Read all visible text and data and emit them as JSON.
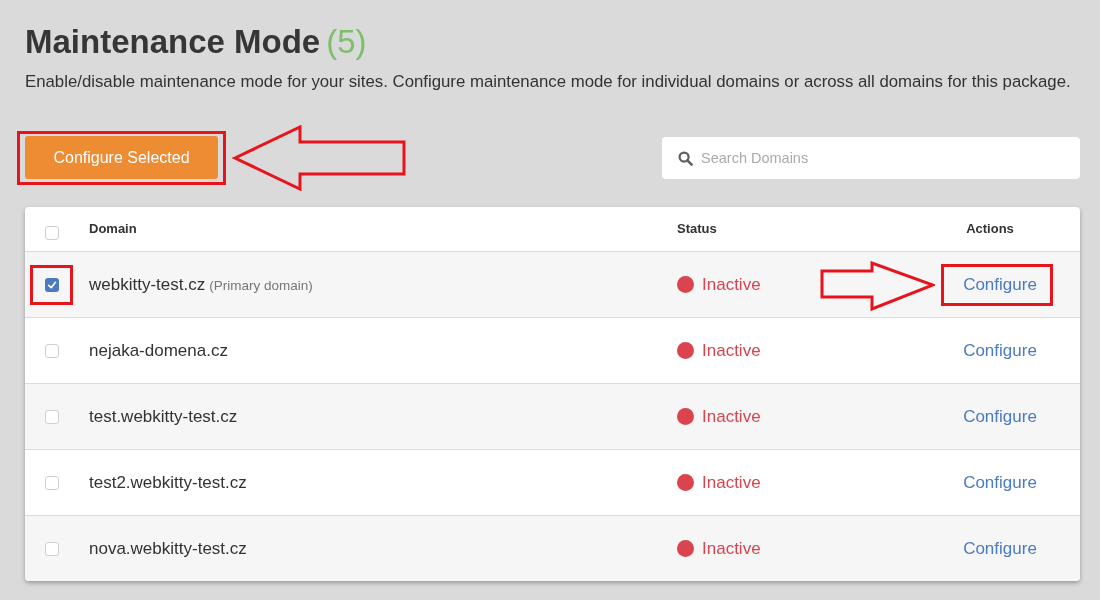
{
  "header": {
    "title": "Maintenance Mode",
    "count": "(5)",
    "description": "Enable/disable maintenance mode for your sites. Configure maintenance mode for individual domains or across all domains for this package."
  },
  "toolbar": {
    "configure_selected_button": {
      "label": "Configure Selected",
      "highlighted": true
    },
    "search": {
      "placeholder": "Search Domains"
    }
  },
  "table": {
    "select_all": {
      "checked": false
    },
    "columns": [
      "Domain",
      "Status",
      "Actions"
    ],
    "rows": [
      {
        "checked": true,
        "highlighted": true,
        "domain": "webkitty-test.cz",
        "note": "(Primary domain)",
        "status": {
          "label": "Inactive",
          "active": false
        },
        "action": "Configure"
      },
      {
        "checked": false,
        "highlighted": false,
        "domain": "nejaka-domena.cz",
        "status": {
          "label": "Inactive",
          "active": false
        },
        "action": "Configure"
      },
      {
        "checked": false,
        "highlighted": false,
        "domain": "test.webkitty-test.cz",
        "status": {
          "label": "Inactive",
          "active": false
        },
        "action": "Configure"
      },
      {
        "checked": false,
        "highlighted": false,
        "domain": "test2.webkitty-test.cz",
        "status": {
          "label": "Inactive",
          "active": false
        },
        "action": "Configure"
      },
      {
        "checked": false,
        "highlighted": false,
        "domain": "nova.webkitty-test.cz",
        "status": {
          "label": "Inactive",
          "active": false
        },
        "action": "Configure"
      }
    ]
  }
}
